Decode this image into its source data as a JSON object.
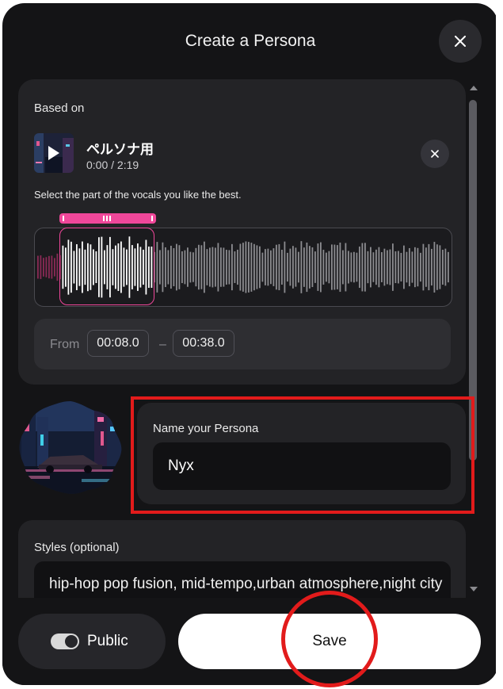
{
  "modal": {
    "title": "Create a Persona"
  },
  "based_on": {
    "label": "Based on",
    "song_title": "ペルソナ用",
    "song_time": "0:00 / 2:19",
    "instruction": "Select the part of the vocals you like the best.",
    "range": {
      "from_label": "From",
      "from_value": "00:08.0",
      "separator": "–",
      "to_value": "00:38.0"
    }
  },
  "name_section": {
    "label": "Name your Persona",
    "value": "Nyx"
  },
  "styles_section": {
    "label": "Styles (optional)",
    "value": "hip-hop pop fusion, mid-tempo,urban atmosphere,night city"
  },
  "footer": {
    "public_label": "Public",
    "public_toggle_on": true,
    "save_label": "Save"
  },
  "icons": {
    "close": "close-icon",
    "play": "play-icon",
    "remove_song": "close-icon"
  },
  "colors": {
    "background": "#141416",
    "card": "#232326",
    "accent_pink": "#f0479a",
    "annotation_red": "#e21b1b",
    "save_button": "#ffffff"
  }
}
